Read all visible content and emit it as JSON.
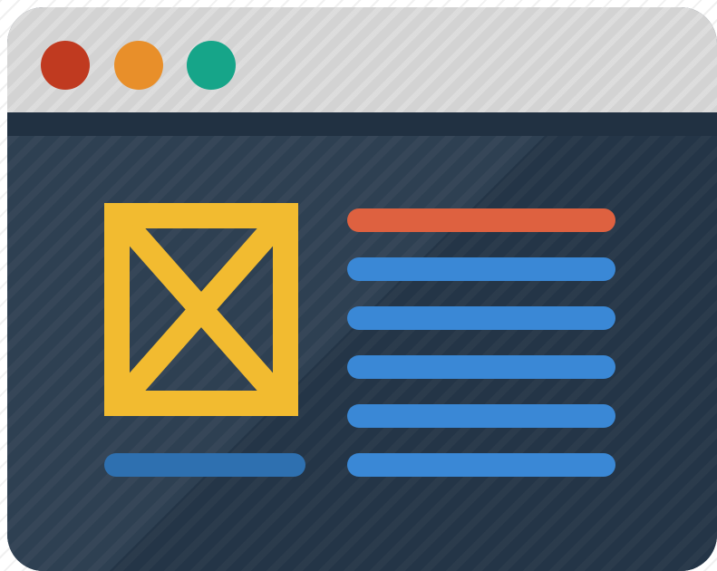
{
  "window": {
    "controls": [
      {
        "name": "close",
        "color": "#c03a20"
      },
      {
        "name": "minimize",
        "color": "#e88f2a"
      },
      {
        "name": "maximize",
        "color": "#16a589"
      }
    ]
  },
  "colors": {
    "titlebar": "#d3d3d3",
    "content": "#26384b",
    "image_placeholder": "#f2bb30",
    "heading_line": "#de6140",
    "text_line": "#3a88d6",
    "caption_line": "#2e70b0"
  },
  "content": {
    "image_placeholder": {
      "icon": "image-placeholder-icon"
    },
    "text_lines": 5
  }
}
